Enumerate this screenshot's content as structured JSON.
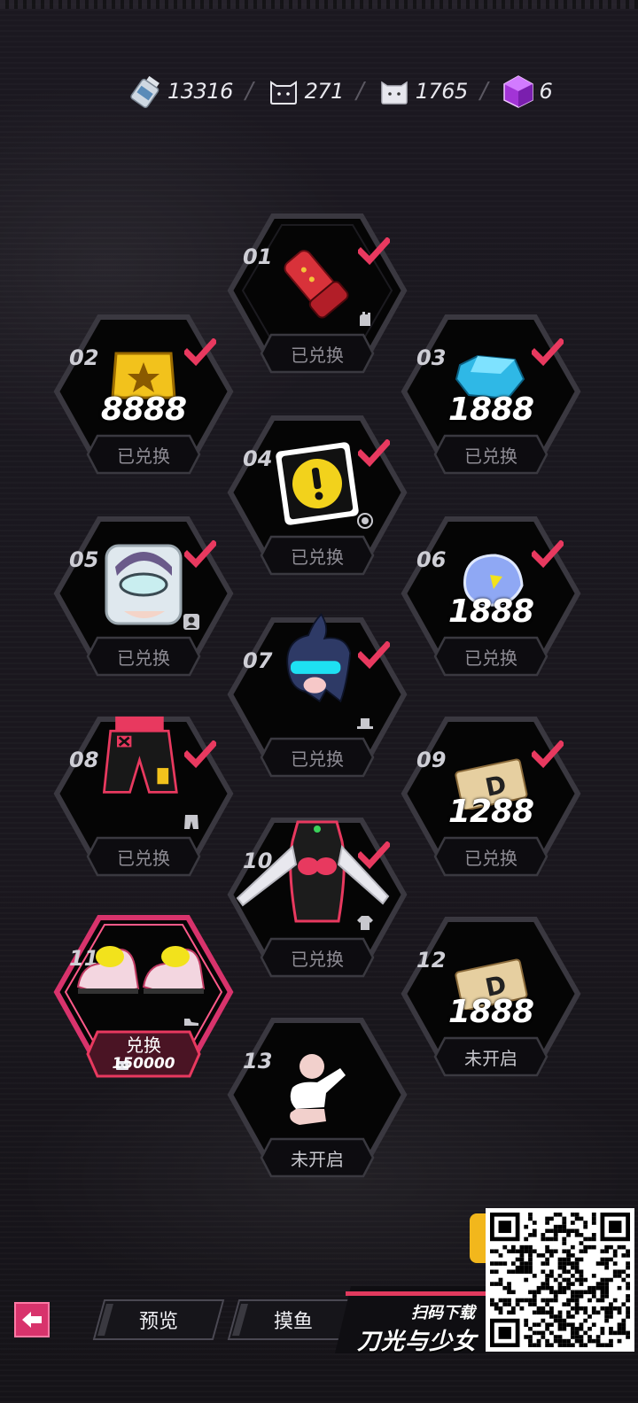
{
  "currencies": [
    {
      "name": "bottle-currency-icon",
      "value": "13316"
    },
    {
      "name": "dark-cat-token-icon",
      "value": "271"
    },
    {
      "name": "white-cat-token-icon",
      "value": "1765"
    },
    {
      "name": "purple-cube-icon",
      "value": "6"
    }
  ],
  "separator": "/",
  "tiles": [
    {
      "number": "01",
      "item": "red-gauntlet-icon",
      "qty": "",
      "status": "已兑换",
      "claimed": true,
      "type_icon": "glove-icon"
    },
    {
      "number": "02",
      "item": "gold-badge-icon",
      "qty": "8888",
      "status": "已兑换",
      "claimed": true,
      "type_icon": ""
    },
    {
      "number": "03",
      "item": "blue-crystal-icon",
      "qty": "1888",
      "status": "已兑换",
      "claimed": true,
      "type_icon": ""
    },
    {
      "number": "04",
      "item": "exclamation-emote-icon",
      "qty": "",
      "status": "已兑换",
      "claimed": true,
      "type_icon": "target-icon"
    },
    {
      "number": "05",
      "item": "avatar-portrait-icon",
      "qty": "",
      "status": "已兑换",
      "claimed": true,
      "type_icon": "portrait-icon"
    },
    {
      "number": "06",
      "item": "gem-bag-icon",
      "qty": "1888",
      "status": "已兑换",
      "claimed": true,
      "type_icon": ""
    },
    {
      "number": "07",
      "item": "blue-hair-visor-icon",
      "qty": "",
      "status": "已兑换",
      "claimed": true,
      "type_icon": "hat-icon"
    },
    {
      "number": "08",
      "item": "red-shorts-icon",
      "qty": "",
      "status": "已兑换",
      "claimed": true,
      "type_icon": "pants-icon"
    },
    {
      "number": "09",
      "item": "gold-plate-icon",
      "qty": "1288",
      "status": "已兑换",
      "claimed": true,
      "type_icon": ""
    },
    {
      "number": "10",
      "item": "black-top-icon",
      "qty": "",
      "status": "已兑换",
      "claimed": true,
      "type_icon": "shirt-icon"
    },
    {
      "number": "11",
      "item": "yellow-sneakers-icon",
      "qty": "",
      "status": "兑换",
      "claimed": false,
      "type_icon": "shoe-icon",
      "cost": "150000"
    },
    {
      "number": "12",
      "item": "gold-plate-icon",
      "qty": "1888",
      "status": "未开启",
      "claimed": false,
      "type_icon": ""
    },
    {
      "number": "13",
      "item": "pointing-emote-icon",
      "qty": "",
      "status": "未开启",
      "claimed": false,
      "type_icon": ""
    }
  ],
  "nav": {
    "back_icon": "back-arrow-icon",
    "preview_label": "预览",
    "fish_label": "摸鱼"
  },
  "promo": {
    "scan_text": "扫码下载",
    "game_name": "刀光与少女"
  },
  "colors": {
    "accent": "#e13a5e",
    "background": "#19161c",
    "active_frame": "#d8336c"
  }
}
